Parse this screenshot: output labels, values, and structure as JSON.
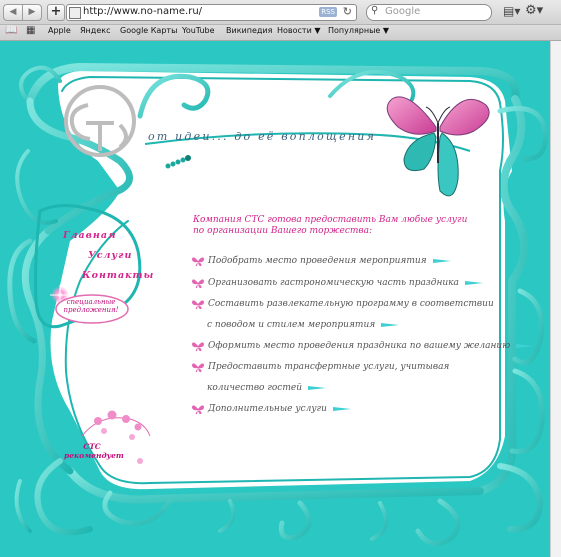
{
  "browser": {
    "url": "http://www.no-name.ru/",
    "rss_label": "RSS",
    "search_placeholder": "Google",
    "bookmarks": [
      "Apple",
      "Яндекс",
      "Google Карты",
      "YouTube",
      "Википедия",
      "Новости ▼",
      "Популярные ▼"
    ]
  },
  "site": {
    "tagline": "от идеи... до её воплощения",
    "logo": "СТС",
    "menu": [
      "Главная",
      "Услуги",
      "Контакты"
    ],
    "special_line1": "специальные",
    "special_line2": "предложения!",
    "recommend_line1": "СТС",
    "recommend_line2": "рекомендует",
    "intro_line1": "Компания СТС готова предоставить Вам любые услуги",
    "intro_line2": "по организации Вашего торжества:",
    "services": [
      "Подобрать место проведения мероприятия",
      "Организовать гастрономическую часть праздника",
      "Составить развлекательную программу в соответствии",
      "с поводом и стилем мероприятия",
      "Оформить место проведения праздника по вашему желанию",
      "Предоставить трансфертные услуги, учитывая",
      "количество гостей",
      "Дополнительные услуги"
    ]
  },
  "colors": {
    "background": "#2bc7c2",
    "accent_pink": "#d2248a",
    "tagline": "#3f5f7a"
  }
}
